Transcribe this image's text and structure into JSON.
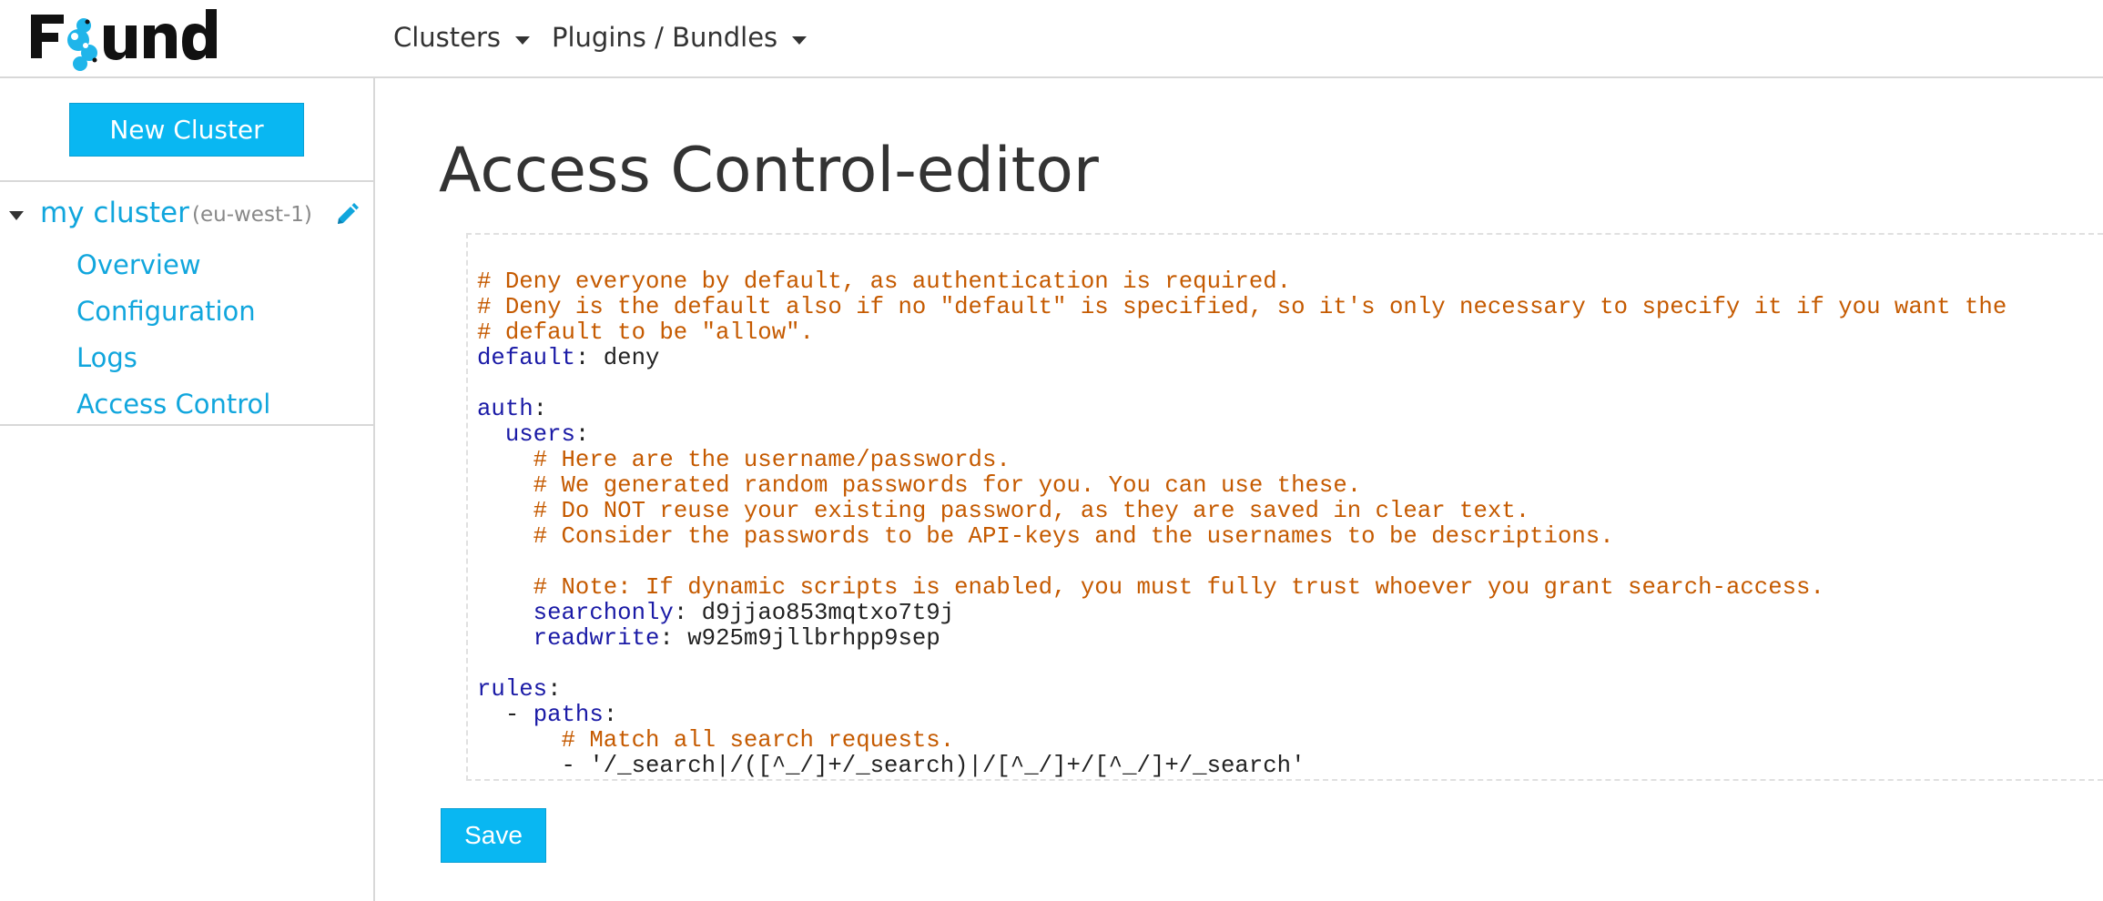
{
  "brand": {
    "logo_text": "Found"
  },
  "nav": {
    "items": [
      {
        "label": "Clusters"
      },
      {
        "label": "Plugins / Bundles"
      }
    ]
  },
  "sidebar": {
    "new_cluster_label": "New Cluster",
    "cluster": {
      "name": "my cluster",
      "region": "(eu-west-1)"
    },
    "links": [
      {
        "label": "Overview"
      },
      {
        "label": "Configuration"
      },
      {
        "label": "Logs"
      },
      {
        "label": "Access Control"
      }
    ]
  },
  "main": {
    "title": "Access Control-editor",
    "save_label": "Save",
    "code_lines": [
      {
        "indent": "",
        "comment": "# Deny everyone by default, as authentication is required."
      },
      {
        "indent": "",
        "comment": "# Deny is the default also if no \"default\" is specified, so it's only necessary to specify it if you want the"
      },
      {
        "indent": "",
        "comment": "# default to be \"allow\"."
      },
      {
        "indent": "",
        "key": "default",
        "sep": ": ",
        "value": "deny"
      },
      {
        "indent": ""
      },
      {
        "indent": "",
        "key": "auth",
        "sep": ":"
      },
      {
        "indent": "  ",
        "key": "users",
        "sep": ":"
      },
      {
        "indent": "    ",
        "comment": "# Here are the username/passwords."
      },
      {
        "indent": "    ",
        "comment": "# We generated random passwords for you. You can use these."
      },
      {
        "indent": "    ",
        "comment": "# Do NOT reuse your existing password, as they are saved in clear text."
      },
      {
        "indent": "    ",
        "comment": "# Consider the passwords to be API-keys and the usernames to be descriptions."
      },
      {
        "indent": ""
      },
      {
        "indent": "    ",
        "comment": "# Note: If dynamic scripts is enabled, you must fully trust whoever you grant search-access."
      },
      {
        "indent": "    ",
        "key": "searchonly",
        "sep": ": ",
        "value": "d9jjao853mqtxo7t9j"
      },
      {
        "indent": "    ",
        "key": "readwrite",
        "sep": ": ",
        "value": "w925m9jllbrhpp9sep"
      },
      {
        "indent": ""
      },
      {
        "indent": "",
        "key": "rules",
        "sep": ":"
      },
      {
        "indent": "  ",
        "value": "- ",
        "key": "paths",
        "sep": ":"
      },
      {
        "indent": "      ",
        "comment": "# Match all search requests."
      },
      {
        "indent": "      ",
        "value": "- '/_search|/([^_/]+/_search)|/[^_/]+/[^_/]+/_search'"
      }
    ]
  },
  "colors": {
    "accent": "#09b7f2",
    "link": "#11a6dd",
    "comment": "#c55a00",
    "key": "#1a1aa6"
  }
}
